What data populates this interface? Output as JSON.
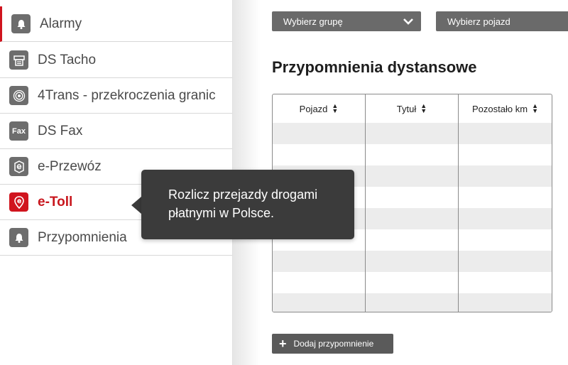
{
  "sidebar": {
    "items": [
      {
        "label": "Alarmy",
        "icon": "bell-icon",
        "active": false
      },
      {
        "label": "DS Tacho",
        "icon": "tacho-printer-icon",
        "active": false
      },
      {
        "label": "4Trans - przekroczenia granic",
        "icon": "target-icon",
        "active": false
      },
      {
        "label": "DS Fax",
        "icon": "fax-icon",
        "icon_text": "Fax",
        "active": false
      },
      {
        "label": "e-Przewóz",
        "icon": "e-document-icon",
        "active": false
      },
      {
        "label": "e-Toll",
        "icon": "etoll-pin-icon",
        "active": true
      },
      {
        "label": "Przypomnienia",
        "icon": "bell-icon",
        "active": false
      }
    ]
  },
  "filters": {
    "group_select": "Wybierz grupę",
    "vehicle_select": "Wybierz pojazd"
  },
  "main": {
    "title": "Przypomnienia dystansowe",
    "table": {
      "columns": [
        "Pojazd",
        "Tytuł",
        "Pozostało km"
      ],
      "rows": []
    },
    "add_button": "Dodaj przypomnienie"
  },
  "tooltip": {
    "text": "Rozlicz przejazdy drogami płatnymi w Polsce."
  },
  "colors": {
    "accent_red": "#c8161d",
    "icon_gray": "#6d6d6d",
    "tooltip_bg": "#3b3b3b",
    "button_gray": "#5a5a5a"
  }
}
